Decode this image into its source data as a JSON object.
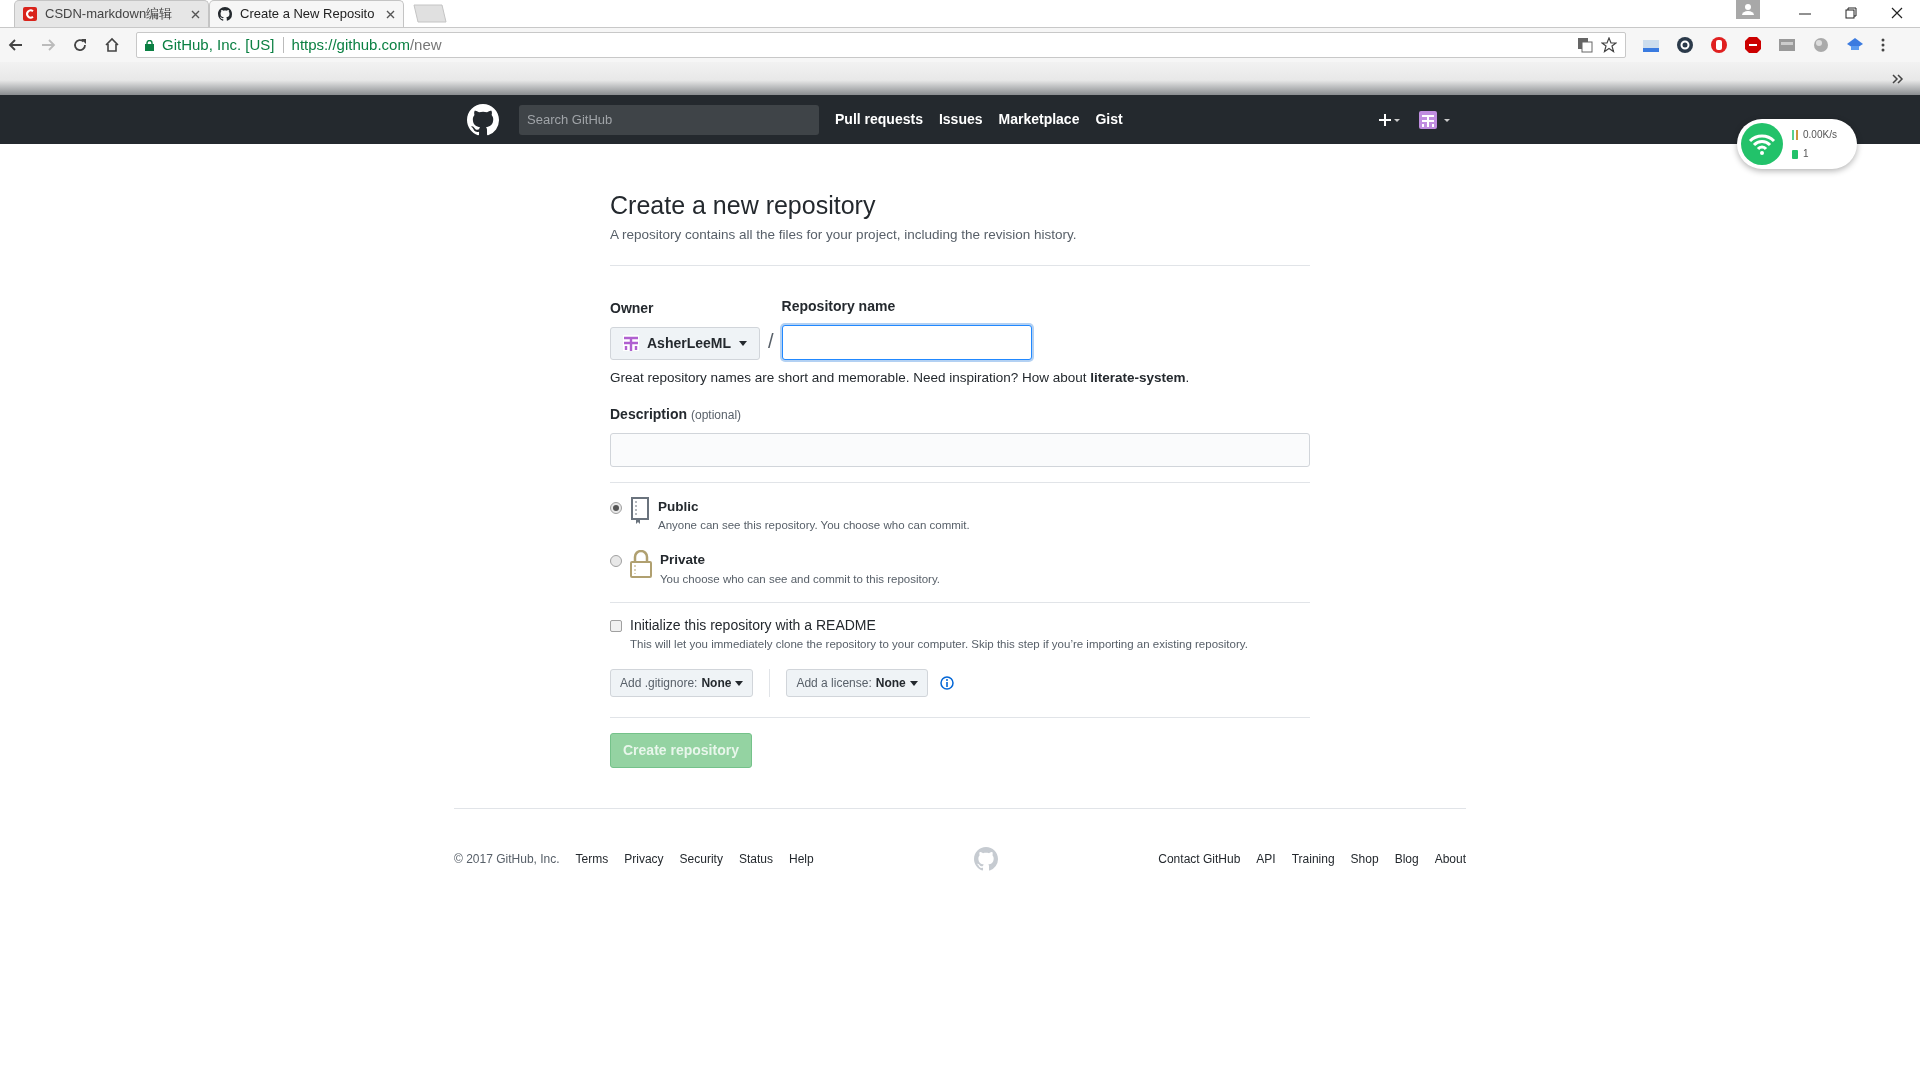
{
  "browser": {
    "tabs": [
      {
        "title": "CSDN-markdown编辑",
        "selected": false,
        "kind": "csdn"
      },
      {
        "title": "Create a New Reposito",
        "selected": true,
        "kind": "github"
      }
    ],
    "security_label": "GitHub, Inc. [US]",
    "url_host": "https://github.com",
    "url_path": "/new"
  },
  "header": {
    "search_placeholder": "Search GitHub",
    "nav": [
      "Pull requests",
      "Issues",
      "Marketplace",
      "Gist"
    ]
  },
  "network_widget": {
    "speed": "0.00K/s",
    "devices": "1"
  },
  "page": {
    "title": "Create a new repository",
    "subtitle": "A repository contains all the files for your project, including the revision history.",
    "owner_label": "Owner",
    "owner": "AsherLeeML",
    "separator": "/",
    "name_label": "Repository name",
    "hint": "Great repository names are short and memorable. Need inspiration? How about **literate-system**.",
    "description_label": "Description",
    "description_optional": "(optional)",
    "visibility": [
      {
        "kind": "public",
        "label": "Public",
        "note": "Anyone can see this repository. You choose who can commit.",
        "selected": true
      },
      {
        "kind": "private",
        "label": "Private",
        "note": "You choose who can see and commit to this repository.",
        "selected": false
      }
    ],
    "readme": {
      "label": "Initialize this repository with a README",
      "note": "This will let you immediately clone the repository to your computer. Skip this step if you’re importing an existing repository.",
      "checked": false
    },
    "gitignore": {
      "label": "Add .gitignore:",
      "value": "None"
    },
    "license": {
      "label": "Add a license:",
      "value": "None"
    },
    "create_button": {
      "label": "Create repository",
      "disabled": true
    }
  },
  "footer": {
    "copyright": "© 2017 GitHub, Inc.",
    "left_links": [
      "Terms",
      "Privacy",
      "Security",
      "Status",
      "Help"
    ],
    "right_links": [
      "Contact GitHub",
      "API",
      "Training",
      "Shop",
      "Blog",
      "About"
    ]
  }
}
